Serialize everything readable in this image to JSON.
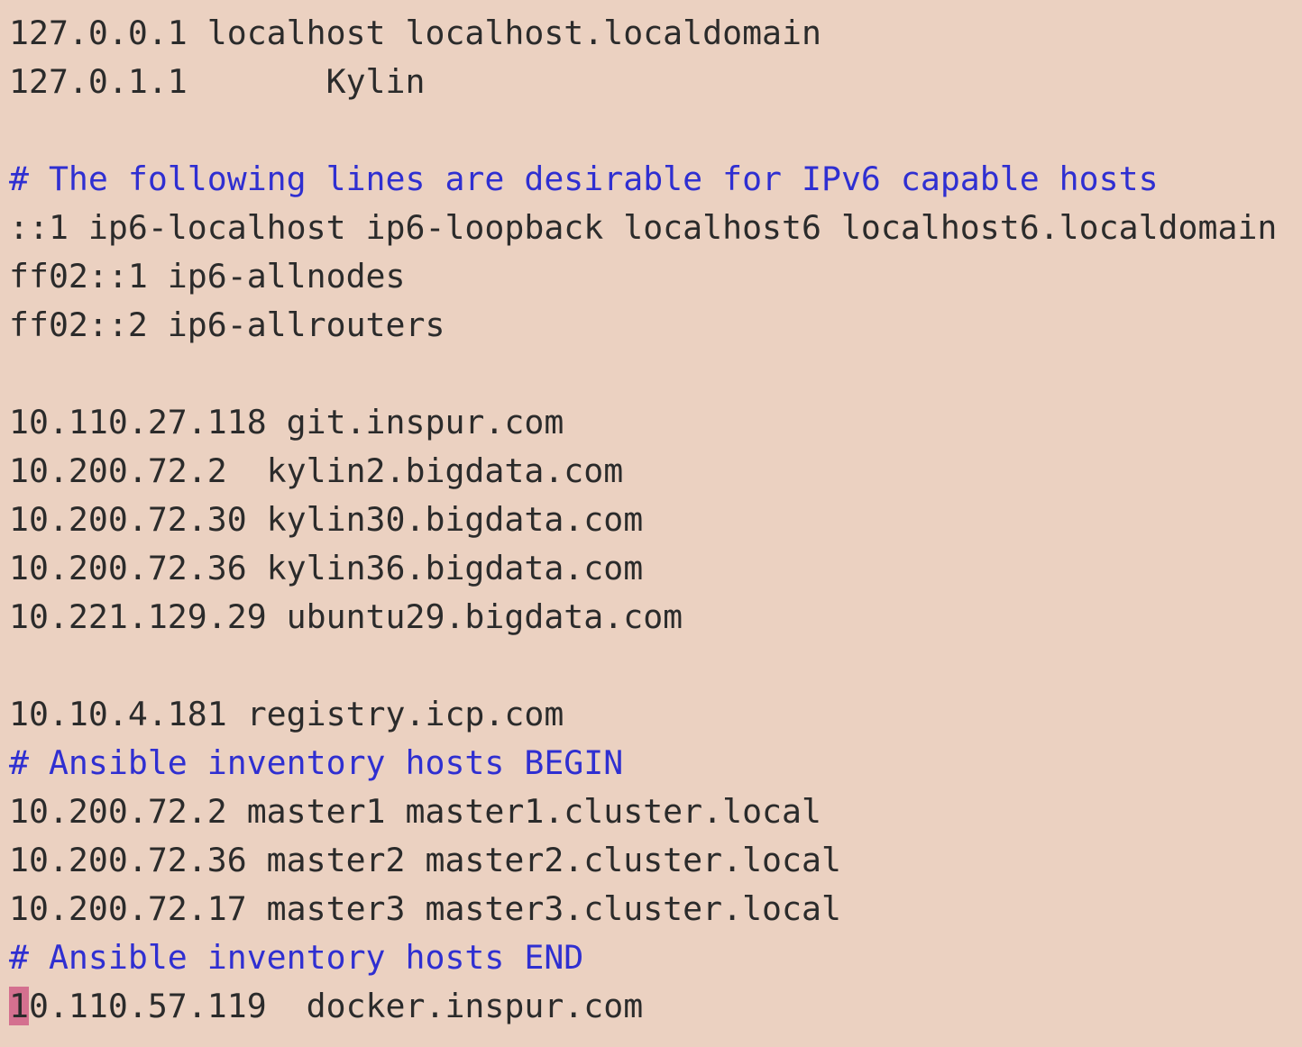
{
  "editor": {
    "lines": [
      "127.0.0.1 localhost localhost.localdomain",
      "127.0.1.1       Kylin",
      "",
      "# The following lines are desirable for IPv6 capable hosts",
      "::1 ip6-localhost ip6-loopback localhost6 localhost6.localdomain",
      "ff02::1 ip6-allnodes",
      "ff02::2 ip6-allrouters",
      "",
      "10.110.27.118 git.inspur.com",
      "10.200.72.2  kylin2.bigdata.com",
      "10.200.72.30 kylin30.bigdata.com",
      "10.200.72.36 kylin36.bigdata.com",
      "10.221.129.29 ubuntu29.bigdata.com",
      "",
      "10.10.4.181 registry.icp.com",
      "# Ansible inventory hosts BEGIN",
      "10.200.72.2 master1 master1.cluster.local",
      "10.200.72.36 master2 master2.cluster.local",
      "10.200.72.17 master3 master3.cluster.local",
      "# Ansible inventory hosts END"
    ],
    "cursor_line": {
      "cursor_char": "1",
      "rest": "0.110.57.119  docker.inspur.com"
    }
  },
  "colors": {
    "background": "#ebd1c1",
    "text": "#2b2b2b",
    "comment": "#2f2fd1",
    "cursor": "#d4708f"
  }
}
